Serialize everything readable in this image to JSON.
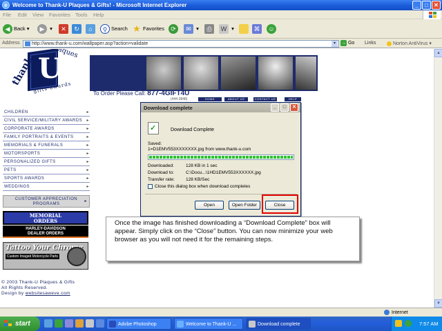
{
  "window": {
    "title": "Welcome to Thank-U Plaques & Gifts! - Microsoft Internet Explorer",
    "icon": "ie-icon"
  },
  "menubar": [
    "File",
    "Edit",
    "View",
    "Favorites",
    "Tools",
    "Help"
  ],
  "toolbar": {
    "back": "Back",
    "search": "Search",
    "favorites": "Favorites"
  },
  "address": {
    "label": "Address",
    "url": "http://www.thank-u.com/wallpaper.asp?action=validate",
    "go": "Go",
    "links": "Links",
    "norton": "Norton AntiVirus"
  },
  "site": {
    "logo": {
      "thank": "thank",
      "u": "U",
      "plaques": "plaques",
      "gifts": "gifts·awards"
    },
    "order_label": "To Order Please Call:",
    "order_phone": "877-4GIFT4U",
    "order_phone_alt": "(444-3848)",
    "nav_tabs": [
      "HOME",
      "ABOUT US",
      "CONTACT US",
      "HELP"
    ],
    "menu": [
      "CHILDREN",
      "CIVIL SERVICE/MILITARY AWARDS",
      "CORPORATE AWARDS",
      "FAMILY PORTRAITS & EVENTS",
      "MEMORIALS & FUNERALS",
      "MOTORSPORTS",
      "PERSONALIZED GIFTS",
      "PETS",
      "SPORTS AWARDS",
      "WEDDINGS"
    ],
    "customer_appreciation": [
      "CUSTOMER APPRECIATION",
      "PROGRAMS"
    ],
    "ad_memorial": [
      "MEMORIAL",
      "ORDERS"
    ],
    "ad_harley": [
      "HARLEY-DAVIDSON",
      "DEALER ORDERS"
    ],
    "ad_tattoo_title": "Tattoo Your Chrome",
    "ad_tattoo_sub": "Custom Imaged Motorcycle Parts",
    "footer": {
      "line1": "© 2003 Thank-U Plaques & Gifts",
      "line2": "All Rights Reserved.",
      "line3_prefix": "Design by ",
      "line3_link": "websitesaweve.com"
    }
  },
  "dialog": {
    "title": "Download complete",
    "heading": "Download Complete",
    "saved_label": "Saved:",
    "saved_value": "1=D1EMV553XXXXXXX.jpg from www.thank-u.com",
    "progress": 1.0,
    "rows": [
      {
        "k": "Downloaded:",
        "v": "128 KB in 1 sec"
      },
      {
        "k": "Download to:",
        "v": "C:\\Docu...\\1HD1EMV553XXXXXX.jpg"
      },
      {
        "k": "Transfer rate:",
        "v": "128 KB/Sec"
      }
    ],
    "checkbox": "Close this dialog box when download completes",
    "buttons": {
      "open": "Open",
      "open_folder": "Open Folder",
      "close": "Close"
    }
  },
  "callout": {
    "text": "Once the image has finished downloading a “Download Complete” box will appear. Simply click on the “Close” button. You can now minimize your web browser as you will not need it for the remaining steps."
  },
  "statusbar": {
    "zone": "Internet"
  },
  "taskbar": {
    "start": "start",
    "tasks": [
      "Adobe Photoshop",
      "Welcome to Thank-U ...",
      "Download complete"
    ],
    "clock": "7:57 AM"
  },
  "colors": {
    "brand_navy": "#1d2a6b",
    "highlight_red": "#e00000",
    "xp_blue": "#245edb",
    "start_green": "#3a9a3a"
  }
}
